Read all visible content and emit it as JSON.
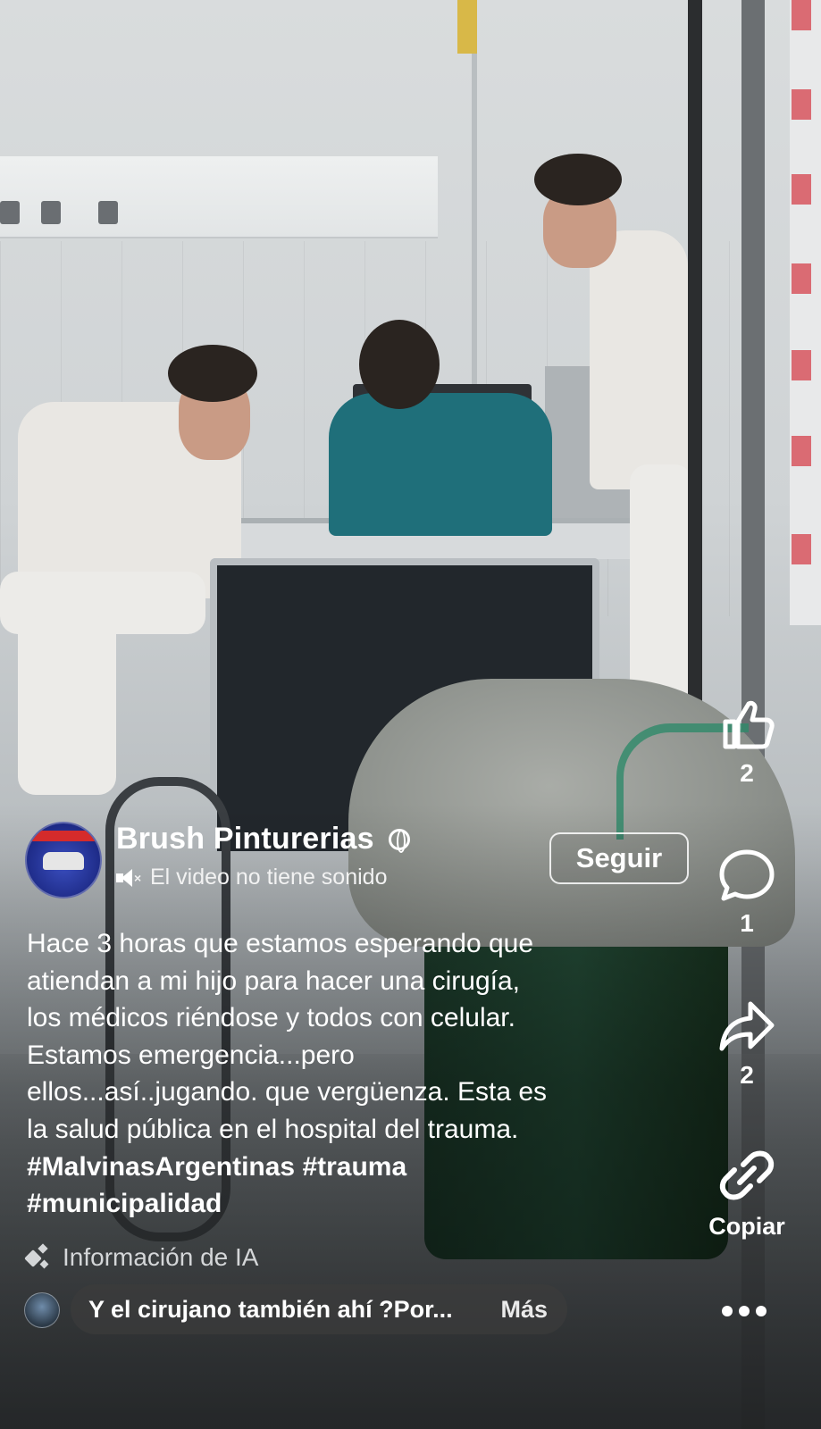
{
  "post": {
    "author": "Brush Pinturerias",
    "sound_status": "El video no tiene sonido",
    "follow_label": "Seguir",
    "caption_lines": [
      "Hace 3 horas que estamos esperando que",
      "atiendan a mi hijo para hacer una cirugía,",
      "los médicos riéndose y todos con celular.",
      "Estamos emergencia...pero",
      "ellos...así..jugando. que vergüenza. Esta es",
      "la salud pública en el hospital del trauma."
    ],
    "hashtags_line1": "#MalvinasArgentinas #trauma",
    "hashtags_line2": "#municipalidad",
    "ai_info_label": "Información de IA"
  },
  "comment_preview": {
    "text": "Y el cirujano también ahí ?Por...",
    "more_label": "Más"
  },
  "actions": {
    "likes": "2",
    "comments": "1",
    "shares": "2",
    "copy_label": "Copiar"
  },
  "icons": {
    "like": "thumbs-up-icon",
    "comment": "speech-bubble-icon",
    "share": "share-arrow-icon",
    "copy": "link-icon",
    "globe": "globe-icon",
    "mute": "speaker-muted-icon",
    "ai": "sparkle-icon",
    "more": "more-dots-icon"
  }
}
